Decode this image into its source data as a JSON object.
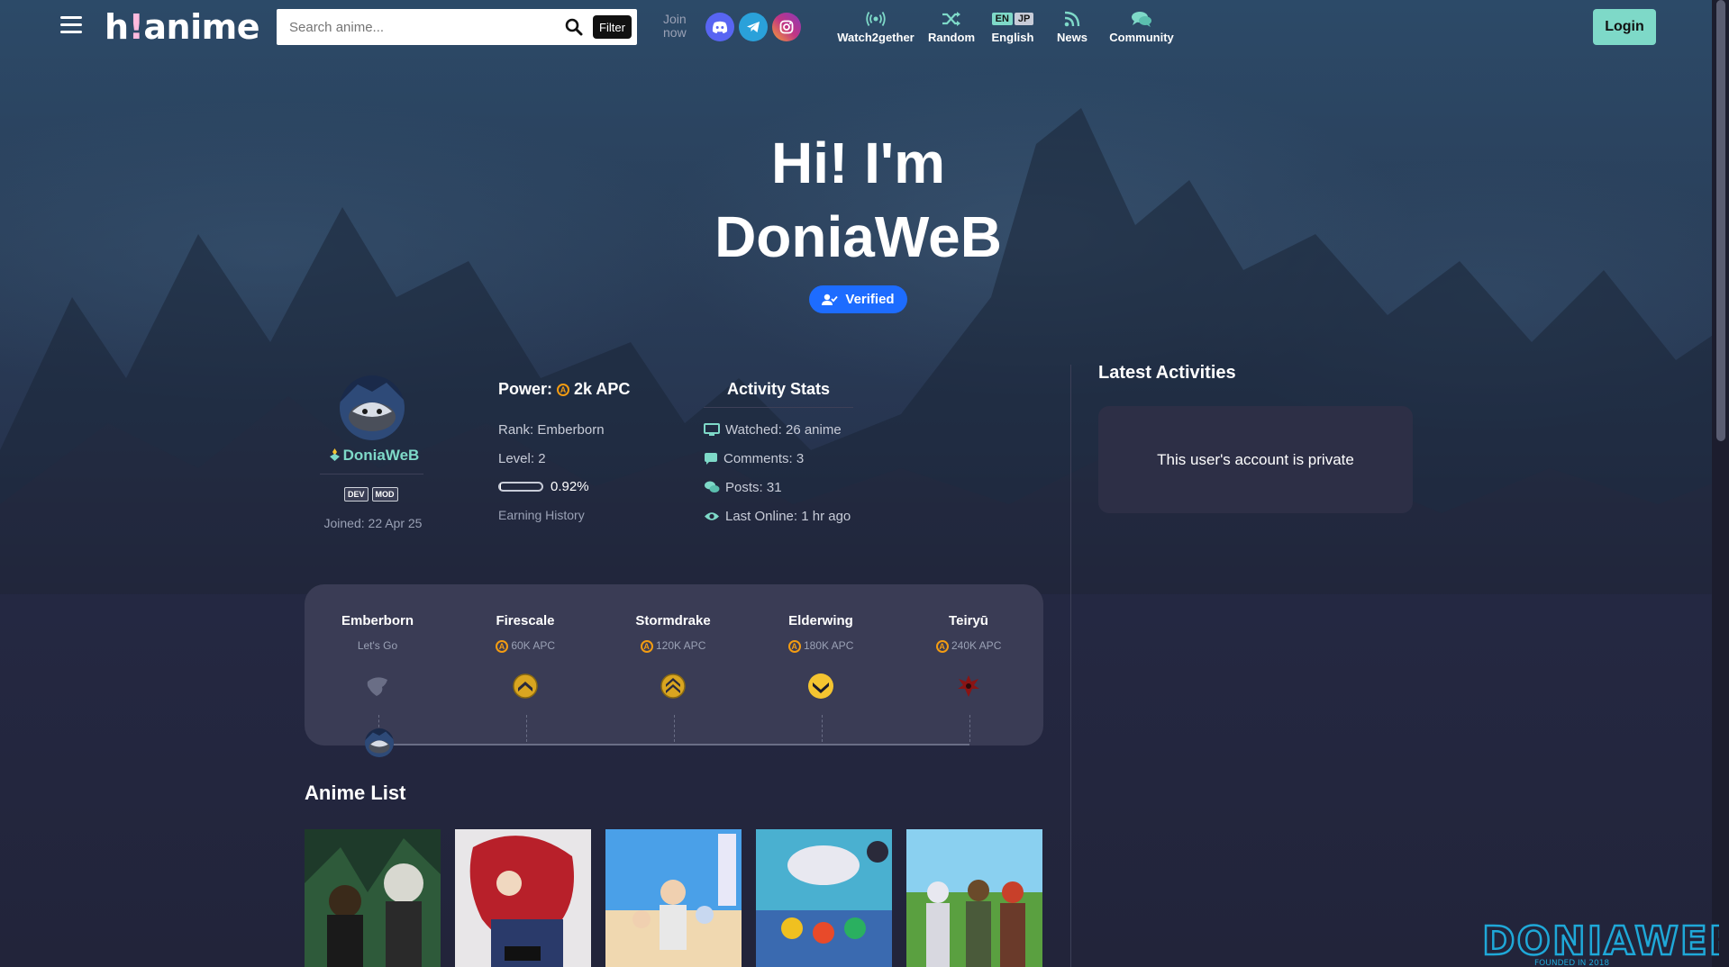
{
  "header": {
    "logo_pre": "h",
    "logo_bang": "!",
    "logo_post": "anime",
    "search_placeholder": "Search anime...",
    "filter_label": "Filter",
    "join_line1": "Join",
    "join_line2": "now",
    "nav": {
      "watch2gether": "Watch2gether",
      "random": "Random",
      "lang_en": "EN",
      "lang_jp": "JP",
      "language": "English",
      "news": "News",
      "community": "Community"
    },
    "login_label": "Login"
  },
  "hero": {
    "line1": "Hi! I'm",
    "line2": "DoniaWeB",
    "verified_label": "Verified"
  },
  "profile": {
    "username": "DoniaWeB",
    "badges": [
      "DEV",
      "MOD"
    ],
    "joined": "Joined: 22 Apr 25"
  },
  "power": {
    "label": "Power:",
    "value": "2k APC",
    "coin_glyph": "A",
    "rank": "Rank: Emberborn",
    "level": "Level: 2",
    "progress_percent": 0.92,
    "progress_text": "0.92%",
    "earning_history": "Earning History"
  },
  "activity": {
    "title": "Activity Stats",
    "watched": "Watched: 26 anime",
    "comments": "Comments: 3",
    "posts": "Posts: 31",
    "last_online": "Last Online: 1 hr ago"
  },
  "latest": {
    "title": "Latest Activities",
    "private_message": "This user's account is private"
  },
  "ranks": [
    {
      "name": "Emberborn",
      "requirement": "Let's Go",
      "icon": "dragon-head-icon"
    },
    {
      "name": "Firescale",
      "requirement": "60K APC",
      "icon": "chevron-badge-icon"
    },
    {
      "name": "Stormdrake",
      "requirement": "120K APC",
      "icon": "double-chevron-badge-icon"
    },
    {
      "name": "Elderwing",
      "requirement": "180K APC",
      "icon": "gold-wing-badge-icon"
    },
    {
      "name": "Teiryū",
      "requirement": "240K APC",
      "icon": "red-dragon-icon"
    }
  ],
  "anime_list": {
    "title": "Anime List"
  },
  "colors": {
    "accent": "#7ed9c8",
    "verified_blue": "#1d6cff",
    "brand_pink": "#ffbade",
    "coin_orange": "#f39c12",
    "discord": "#5865f2",
    "telegram": "#2aa1da",
    "instagram": "#c13584"
  }
}
